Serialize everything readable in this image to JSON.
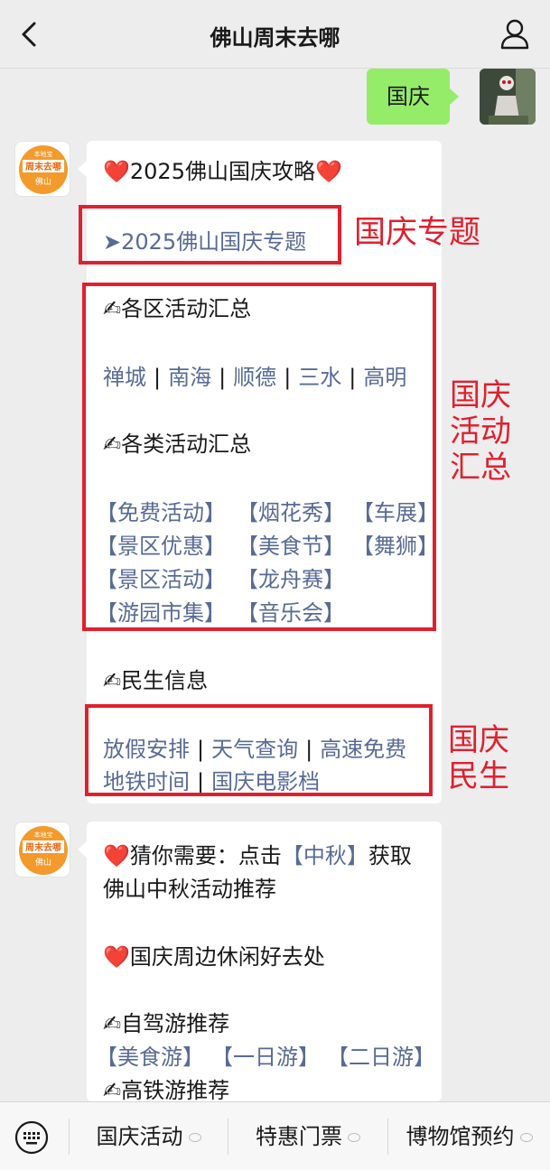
{
  "header": {
    "title": "佛山周末去哪"
  },
  "outgoing": {
    "text": "国庆"
  },
  "brand": {
    "line1": "周末去哪",
    "line2": "佛山",
    "tag": "本地宝"
  },
  "card1": {
    "headline": "❤️2025佛山国庆攻略❤️",
    "topic_link": "➤2025佛山国庆专题",
    "district_title": "✍各区活动汇总",
    "districts": [
      "禅城",
      "南海",
      "顺德",
      "三水",
      "高明"
    ],
    "category_title": "✍各类活动汇总",
    "categories": [
      [
        "【免费活动】",
        "【烟花秀】",
        "【车展】"
      ],
      [
        "【景区优惠】",
        "【美食节】",
        "【舞狮】"
      ],
      [
        "【景区活动】",
        "【龙舟赛】"
      ],
      [
        "【游园市集】",
        "【音乐会】"
      ]
    ],
    "livelihood_title": "✍民生信息",
    "livelihood_row1": [
      "放假安排",
      "天气查询",
      "高速免费"
    ],
    "livelihood_row2": [
      "地铁时间",
      "国庆电影档"
    ]
  },
  "annotations": {
    "topic": "国庆专题",
    "activities": [
      "国庆",
      "活动",
      "汇总"
    ],
    "livelihood": [
      "国庆",
      "民生"
    ]
  },
  "card2": {
    "line1_pre": "❤️猜你需要：点击",
    "line1_link": "【中秋】",
    "line1_post": "获取",
    "line2": "佛山中秋活动推荐",
    "line3": "❤️国庆周边休闲好去处",
    "selfdrive_title": "✍自驾游推荐",
    "selfdrive_links": [
      "【美食游】",
      "【一日游】",
      "【二日游】"
    ],
    "rail_title": "✍高铁游推荐"
  },
  "bottom_menu": [
    "国庆活动",
    "特惠门票",
    "博物馆预约"
  ],
  "colors": {
    "link": "#576b95",
    "annotation_red": "#e0202e",
    "bubble_green": "#95ec69"
  }
}
